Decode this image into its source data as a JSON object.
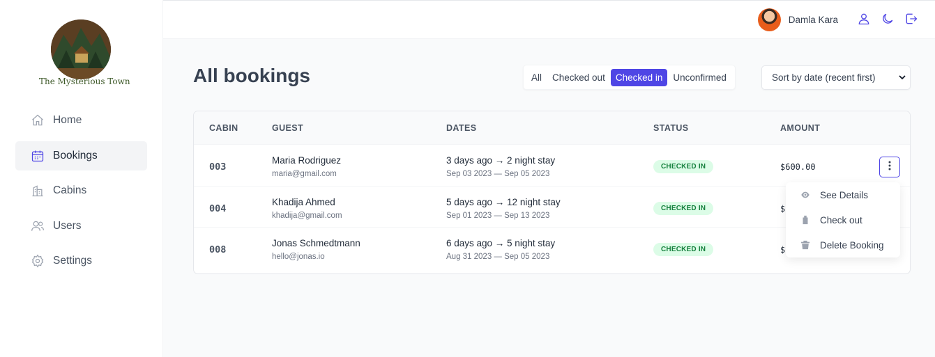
{
  "brand": {
    "name": "The Mysterious Town"
  },
  "nav": {
    "items": [
      {
        "label": "Home",
        "icon": "home-icon"
      },
      {
        "label": "Bookings",
        "icon": "calendar-icon",
        "active": true
      },
      {
        "label": "Cabins",
        "icon": "building-icon"
      },
      {
        "label": "Users",
        "icon": "users-icon"
      },
      {
        "label": "Settings",
        "icon": "gear-icon"
      }
    ]
  },
  "header": {
    "user_name": "Damla Kara"
  },
  "page": {
    "title": "All bookings"
  },
  "filter": {
    "options": [
      "All",
      "Checked out",
      "Checked in",
      "Unconfirmed"
    ],
    "selected": "Checked in"
  },
  "sort": {
    "selected": "Sort by date (recent first)"
  },
  "table": {
    "headers": [
      "CABIN",
      "GUEST",
      "DATES",
      "STATUS",
      "AMOUNT"
    ],
    "rows": [
      {
        "cabin": "003",
        "guest": "Maria Rodriguez",
        "email": "maria@gmail.com",
        "dates": "3 days ago → 2 night stay",
        "range": "Sep 03 2023 — Sep 05 2023",
        "status": "CHECKED IN",
        "amount": "$600.00"
      },
      {
        "cabin": "004",
        "guest": "Khadija Ahmed",
        "email": "khadija@gmail.com",
        "dates": "5 days ago → 12 night stay",
        "range": "Sep 01 2023 — Sep 13 2023",
        "status": "CHECKED IN",
        "amount": "$"
      },
      {
        "cabin": "008",
        "guest": "Jonas Schmedtmann",
        "email": "hello@jonas.io",
        "dates": "6 days ago → 5 night stay",
        "range": "Aug 31 2023 — Sep 05 2023",
        "status": "CHECKED IN",
        "amount": "$"
      }
    ]
  },
  "menu": {
    "items": [
      {
        "label": "See Details",
        "icon": "eye-icon"
      },
      {
        "label": "Check out",
        "icon": "checkout-icon"
      },
      {
        "label": "Delete Booking",
        "icon": "trash-icon"
      }
    ]
  },
  "colors": {
    "accent": "#4f46e5",
    "status_bg": "#dcfce7",
    "status_text": "#15803d"
  }
}
